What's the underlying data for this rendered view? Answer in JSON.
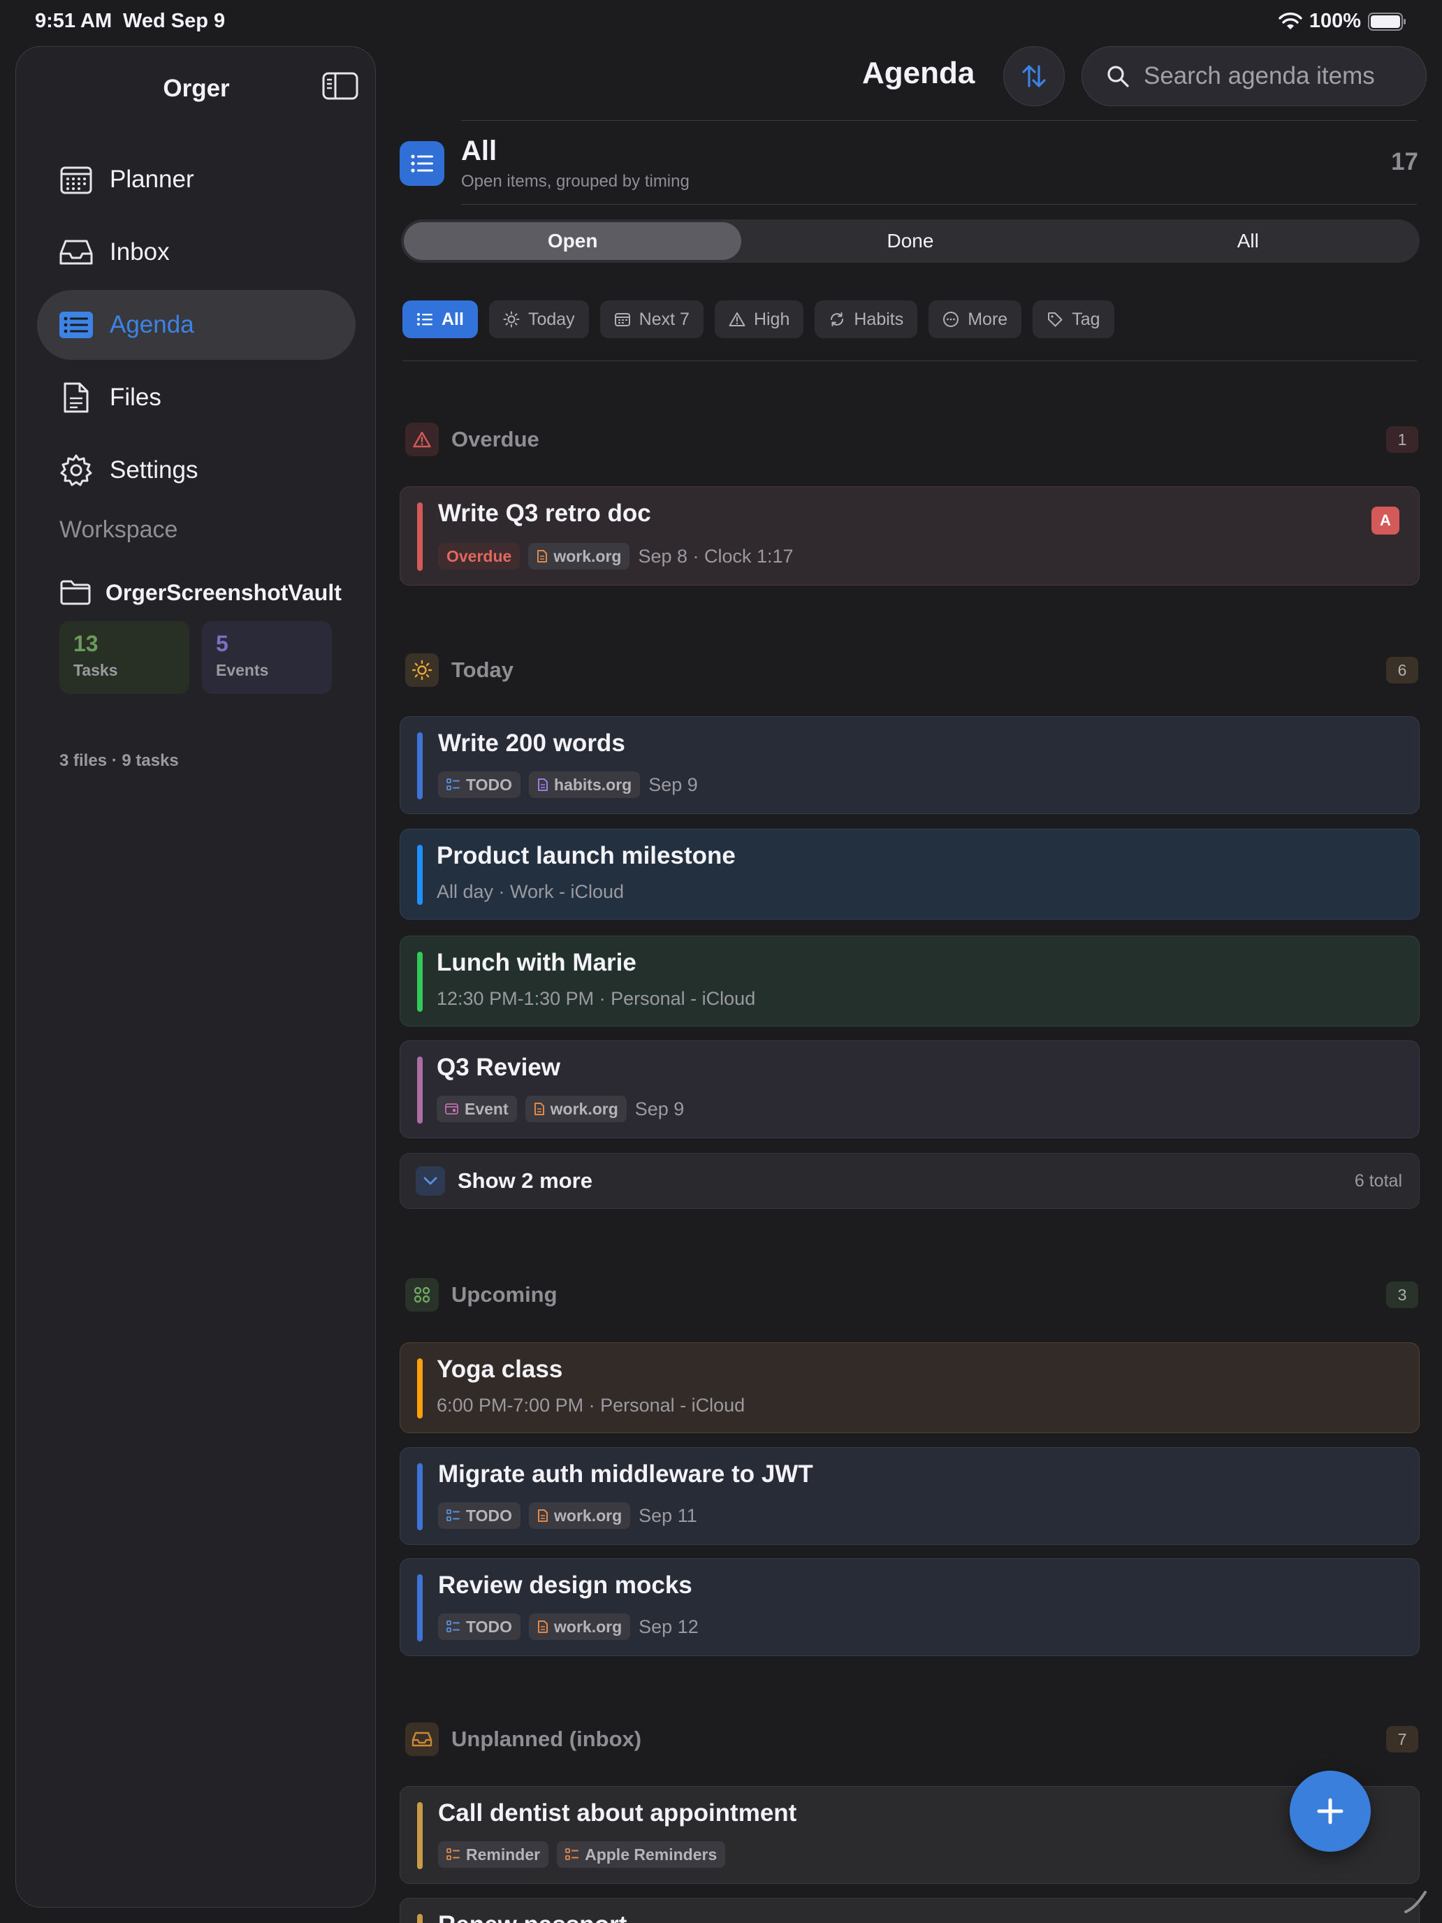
{
  "status_bar": {
    "time": "9:51 AM",
    "date": "Wed Sep 9",
    "battery": "100%"
  },
  "sidebar": {
    "title": "Orger",
    "nav": [
      {
        "label": "Planner",
        "icon": "calendar-grid-icon"
      },
      {
        "label": "Inbox",
        "icon": "tray-icon"
      },
      {
        "label": "Agenda",
        "icon": "list-icon",
        "active": true
      },
      {
        "label": "Files",
        "icon": "document-icon"
      },
      {
        "label": "Settings",
        "icon": "gear-icon"
      }
    ],
    "workspace_label": "Workspace",
    "workspace_name": "OrgerScreenshotVault",
    "tasks_count": "13",
    "tasks_label": "Tasks",
    "events_count": "5",
    "events_label": "Events",
    "summary": "3 files · 9 tasks"
  },
  "header": {
    "title": "Agenda",
    "search_placeholder": "Search agenda items"
  },
  "filter": {
    "title": "All",
    "subtitle": "Open items, grouped by timing",
    "count": "17"
  },
  "segments": [
    "Open",
    "Done",
    "All"
  ],
  "chips": [
    "All",
    "Today",
    "Next 7",
    "High",
    "Habits",
    "More",
    "Tag"
  ],
  "sections": {
    "overdue": {
      "label": "Overdue",
      "count": "1"
    },
    "today": {
      "label": "Today",
      "count": "6"
    },
    "upcoming": {
      "label": "Upcoming",
      "count": "3"
    },
    "unplanned": {
      "label": "Unplanned (inbox)",
      "count": "7"
    }
  },
  "items": {
    "retro": {
      "title": "Write Q3 retro doc",
      "tag": "Overdue",
      "file": "work.org",
      "meta": "Sep 8 · Clock 1:17",
      "priority": "A"
    },
    "words": {
      "title": "Write 200 words",
      "tag": "TODO",
      "file": "habits.org",
      "meta": "Sep 9"
    },
    "launch": {
      "title": "Product launch milestone",
      "meta": "All day · Work - iCloud"
    },
    "lunch": {
      "title": "Lunch with Marie",
      "meta": "12:30 PM-1:30 PM · Personal - iCloud"
    },
    "review": {
      "title": "Q3 Review",
      "tag": "Event",
      "file": "work.org",
      "meta": "Sep 9"
    },
    "yoga": {
      "title": "Yoga class",
      "meta": "6:00 PM-7:00 PM · Personal - iCloud"
    },
    "migrate": {
      "title": "Migrate auth middleware to JWT",
      "tag": "TODO",
      "file": "work.org",
      "meta": "Sep 11"
    },
    "mocks": {
      "title": "Review design mocks",
      "tag": "TODO",
      "file": "work.org",
      "meta": "Sep 12"
    },
    "dentist": {
      "title": "Call dentist about appointment",
      "tag": "Reminder",
      "file": "Apple Reminders"
    },
    "passport": {
      "title": "Renew passport"
    }
  },
  "show_more": {
    "label": "Show 2 more",
    "total": "6 total"
  },
  "colors": {
    "accent": "#3b7fdc",
    "overdue": "#d45a5a",
    "today": "#e2a43a",
    "upcoming": "#5f9a55",
    "inbox": "#c88a3a",
    "task_bar": "#3f74d6",
    "event_blue": "#1e90ff",
    "event_green": "#34c759",
    "event_purple": "#a86fa0",
    "event_orange": "#ff9f0a",
    "reminder": "#c89a4a"
  }
}
